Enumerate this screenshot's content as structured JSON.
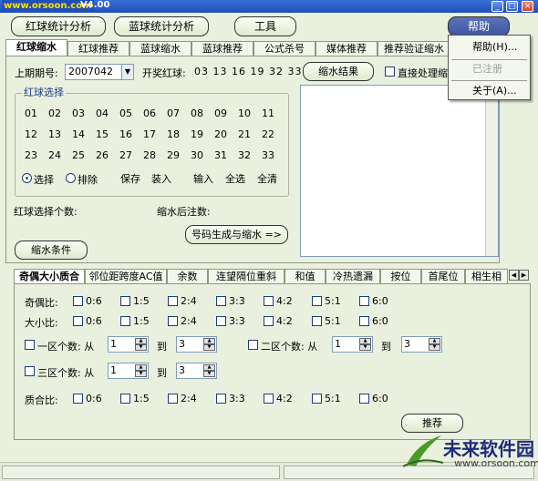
{
  "window": {
    "title": "V4.00",
    "watermark": "www.orsoon.com"
  },
  "menu": {
    "red_analysis": "红球统计分析",
    "blue_analysis": "蓝球统计分析",
    "tools": "工具",
    "help": "帮助"
  },
  "help_menu": {
    "items": [
      "帮助(H)...",
      "已注册",
      "关于(A)..."
    ]
  },
  "top_tabs": [
    "红球缩水",
    "红球推荐",
    "蓝球缩水",
    "蓝球推荐",
    "公式杀号",
    "媒体推荐",
    "推荐验证缩水"
  ],
  "main": {
    "last_issue_label": "上期期号:",
    "last_issue_value": "2007042",
    "draw_label": "开奖红球:",
    "draw_numbers": "03 13 16 19 32 33",
    "shrink_result_button": "缩水结果",
    "direct_process_label": "直接处理缩",
    "red_select_title": "红球选择",
    "numbers": [
      [
        "01",
        "02",
        "03",
        "04",
        "05",
        "06",
        "07",
        "08",
        "09",
        "10",
        "11"
      ],
      [
        "12",
        "13",
        "14",
        "15",
        "16",
        "17",
        "18",
        "19",
        "20",
        "21",
        "22"
      ],
      [
        "23",
        "24",
        "25",
        "26",
        "27",
        "28",
        "29",
        "30",
        "31",
        "32",
        "33"
      ]
    ],
    "select_label": "选择",
    "exclude_label": "排除",
    "save_label": "保存",
    "load_label": "装入",
    "input_label": "输入",
    "select_all_label": "全选",
    "clear_all_label": "全清",
    "red_count_label": "红球选择个数:",
    "after_shrink_label": "缩水后注数:",
    "generate_button": "号码生成与缩水 =>",
    "shrink_condition_button": "缩水条件"
  },
  "bottom_tabs": [
    "奇偶大小质合",
    "邻位距跨度AC值",
    "余数",
    "连望隔位重斜",
    "和值",
    "冷热遗漏",
    "按位",
    "首尾位",
    "相生相"
  ],
  "conditions": {
    "odd_even_label": "奇偶比:",
    "big_small_label": "大小比:",
    "prime_label": "质合比:",
    "ratios": [
      "0:6",
      "1:5",
      "2:4",
      "3:3",
      "4:2",
      "5:1",
      "6:0"
    ],
    "zone1_label": "一区个数: 从",
    "zone2_label": "二区个数: 从",
    "zone3_label": "三区个数: 从",
    "to_label": "到",
    "zone1_from": "1",
    "zone1_to": "3",
    "zone2_from": "1",
    "zone2_to": "3",
    "zone3_from": "1",
    "zone3_to": "3",
    "recommend_button": "推荐"
  },
  "logo": {
    "name": "未来软件园",
    "url": "www.orsoon.com"
  }
}
